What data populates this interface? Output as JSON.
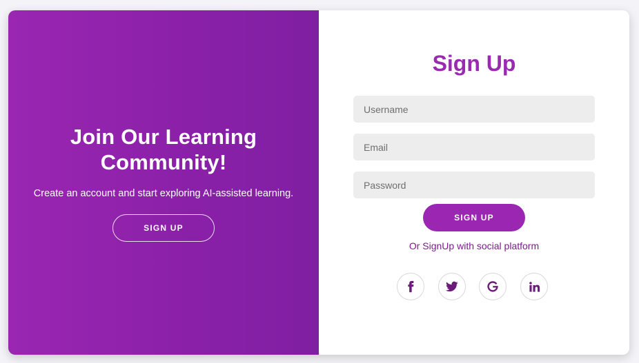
{
  "colors": {
    "accent": "#9a26b2",
    "social_icon": "#6d1b7b"
  },
  "left_panel": {
    "title": "Join Our Learning Community!",
    "description": "Create an account and start exploring AI-assisted learning.",
    "button_label": "SIGN UP"
  },
  "signup_form": {
    "title": "Sign Up",
    "username_placeholder": "Username",
    "email_placeholder": "Email",
    "password_placeholder": "Password",
    "submit_label": "SIGN UP",
    "social_text": "Or SignUp with social platform",
    "social_icons": [
      "facebook-icon",
      "twitter-icon",
      "google-icon",
      "linkedin-icon"
    ]
  }
}
